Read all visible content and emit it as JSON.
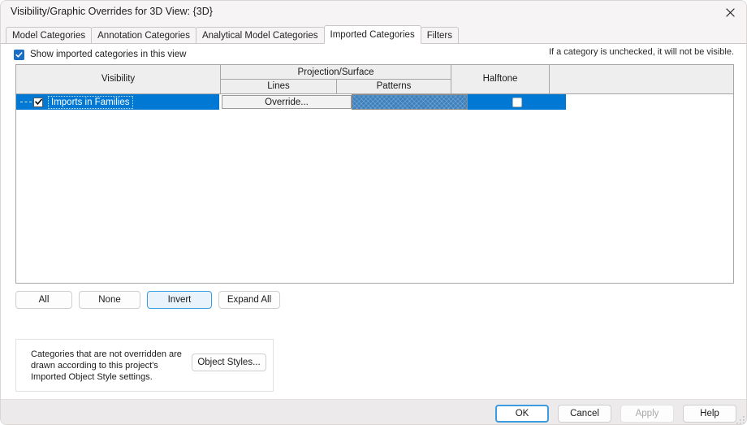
{
  "window": {
    "title": "Visibility/Graphic Overrides for 3D View: {3D}",
    "close_icon": "close-icon"
  },
  "tabs": [
    {
      "label": "Model Categories",
      "active": false
    },
    {
      "label": "Annotation Categories",
      "active": false
    },
    {
      "label": "Analytical Model Categories",
      "active": false
    },
    {
      "label": "Imported Categories",
      "active": true
    },
    {
      "label": "Filters",
      "active": false
    }
  ],
  "options": {
    "show_imported_label": "Show imported categories in this view",
    "show_imported_checked": "true",
    "hint": "If a category is unchecked, it will not be visible."
  },
  "table": {
    "headers": {
      "visibility": "Visibility",
      "projection_surface": "Projection/Surface",
      "lines": "Lines",
      "patterns": "Patterns",
      "halftone": "Halftone"
    },
    "rows": [
      {
        "name": "Imports in Families",
        "visible_checked": "true",
        "lines": "Override...",
        "patterns": "",
        "halftone_checked": "false",
        "selected": "true"
      }
    ]
  },
  "toolbar": {
    "all": "All",
    "none": "None",
    "invert": "Invert",
    "expand_all": "Expand All"
  },
  "note": {
    "text": "Categories that are not overridden are drawn according to this project's Imported Object Style settings.",
    "object_styles_button": "Object Styles..."
  },
  "footer": {
    "ok": "OK",
    "cancel": "Cancel",
    "apply": "Apply",
    "help": "Help"
  },
  "colors": {
    "selection_blue": "#0078d4",
    "pattern_blue": "#3d80bd",
    "focus_blue": "#3b9de0",
    "checkbox_blue": "#1b6ec2",
    "titlebar": "#f7f4f5",
    "footer": "#eceaea"
  }
}
